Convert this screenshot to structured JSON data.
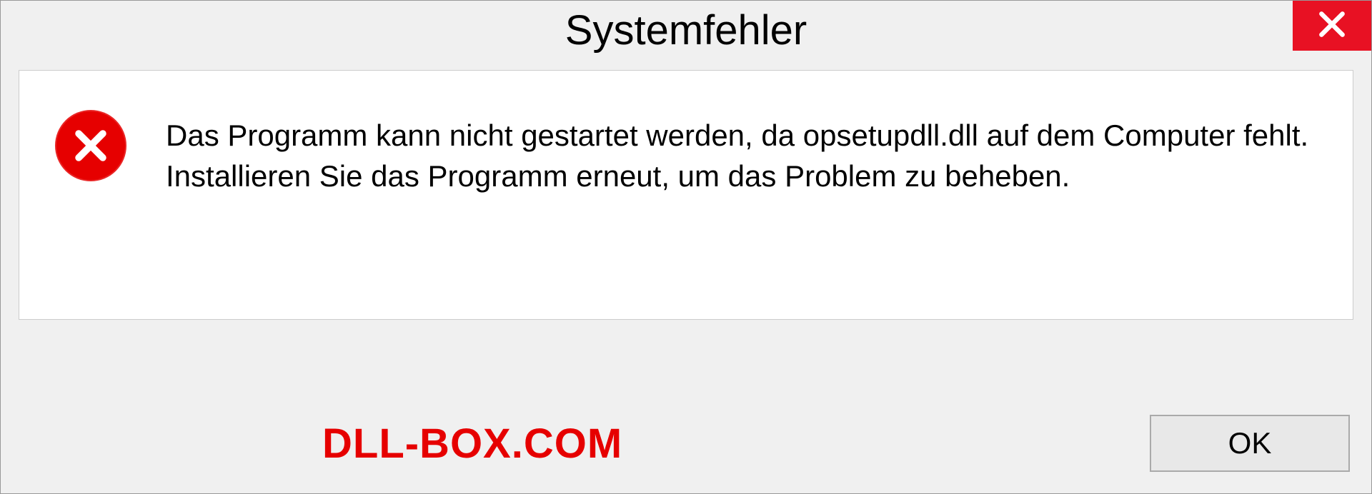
{
  "dialog": {
    "title": "Systemfehler",
    "message": "Das Programm kann nicht gestartet werden, da opsetupdll.dll auf dem Computer fehlt. Installieren Sie das Programm erneut, um das Problem zu beheben.",
    "ok_label": "OK"
  },
  "watermark": "DLL-BOX.COM"
}
